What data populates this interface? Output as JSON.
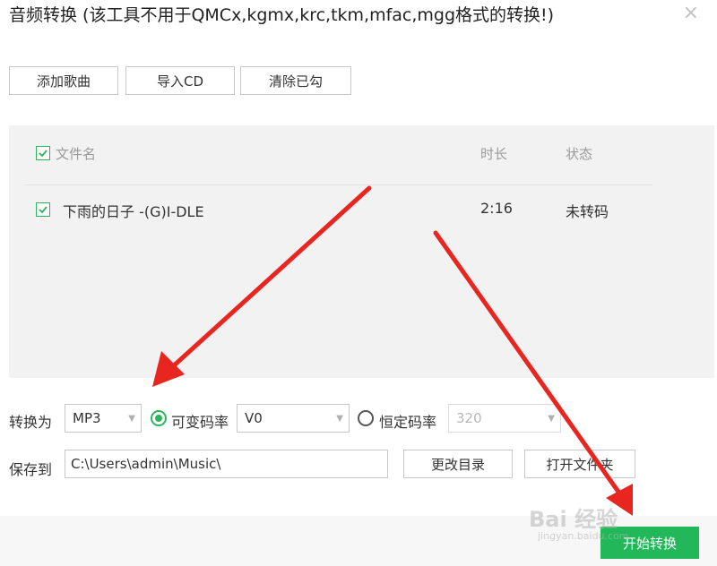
{
  "window": {
    "title": "音频转换 (该工具不用于QMCx,kgmx,krc,tkm,mfac,mgg格式的转换!)",
    "close_symbol": "×"
  },
  "toolbar": {
    "add_songs": "添加歌曲",
    "import_cd": "导入CD",
    "clear_checked": "清除已勾"
  },
  "table": {
    "headers": {
      "filename": "文件名",
      "duration": "时长",
      "status": "状态"
    },
    "rows": [
      {
        "name": "下雨的日子 -(G)I-DLE",
        "duration": "2:16",
        "status": "未转码",
        "checked": true
      }
    ]
  },
  "convert": {
    "label": "转换为",
    "format": "MP3",
    "vbr_label": "可变码率",
    "vbr_value": "V0",
    "cbr_label": "恒定码率",
    "cbr_value": "320",
    "selected_mode": "vbr"
  },
  "save": {
    "label": "保存到",
    "path": "C:\\Users\\admin\\Music\\",
    "change_dir": "更改目录",
    "open_folder": "打开文件夹"
  },
  "start_button": "开始转换",
  "watermark": {
    "main": "Bai 经验",
    "sub": "jingyan.baidu.com"
  },
  "colors": {
    "accent": "#22b85a",
    "arrow": "#e8251f",
    "panel": "#f2f2f2"
  },
  "icons": {
    "close": "close-icon",
    "checkbox": "checkbox-checked-icon",
    "dropdown": "chevron-down-icon",
    "arrow": "red-annotation-arrow"
  }
}
